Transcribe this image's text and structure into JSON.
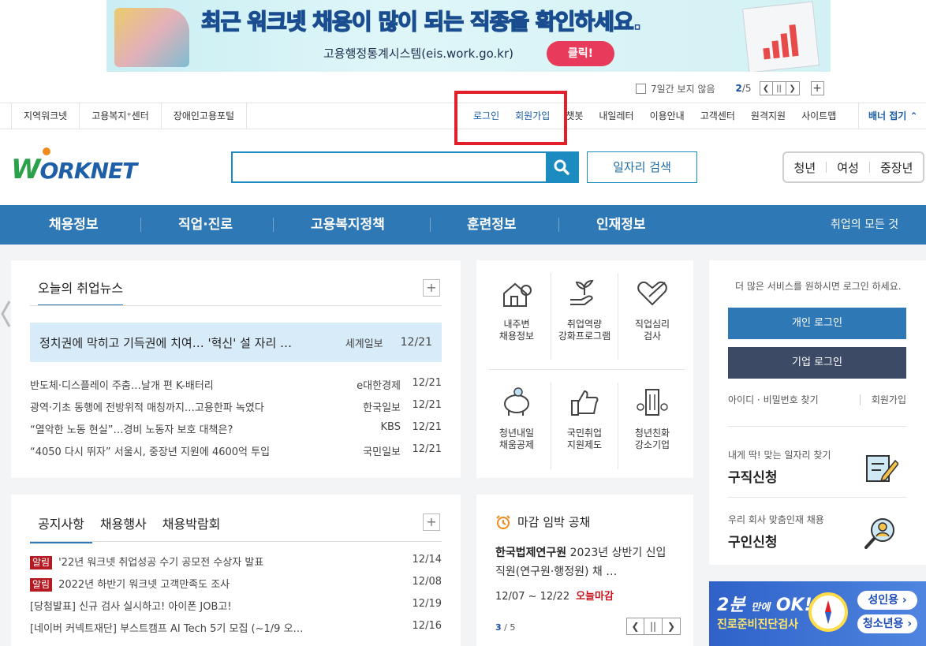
{
  "banner": {
    "headline_a": "최근 워크넷 채용이 많이 되는 ",
    "headline_b": "직종",
    "headline_c": "을 ",
    "headline_d": "확인",
    "headline_e": "하세요.",
    "sub": "고용행정통계시스템(eis.work.go.kr)",
    "click": "클릭!",
    "hide_7days": "7일간 보지 않음",
    "page_current": "2",
    "page_total": "/5"
  },
  "util_left": [
    "지역워크넷",
    "고용복지⁺센터",
    "장애인고용포털"
  ],
  "util_right": [
    "로그인",
    "회원가입",
    "챗봇",
    "내일레터",
    "이용안내",
    "고객센터",
    "원격지원",
    "사이트맵"
  ],
  "banner_close": "배너 접기",
  "logo": {
    "w": "W",
    "rest": "ORKNET"
  },
  "search": {
    "value": "",
    "job_search": "일자리 검색"
  },
  "age_tabs": [
    "청년",
    "여성",
    "중장년"
  ],
  "gnb": [
    "채용정보",
    "직업·진로",
    "고용복지정책",
    "훈련정보",
    "인재정보"
  ],
  "gnb_all": "취업의 모든 것",
  "news": {
    "title": "오늘의 취업뉴스",
    "headline": {
      "title": "정치권에 막히고 기득권에 치여… '혁신' 설 자리 …",
      "source": "세계일보",
      "date": "12/21"
    },
    "items": [
      {
        "title": "반도체·디스플레이 주춤…날개 편 K-배터리",
        "source": "e대한경제",
        "date": "12/21"
      },
      {
        "title": "광역·기초 동행에 전방위적 매칭까지…고용한파 녹였다",
        "source": "한국일보",
        "date": "12/21"
      },
      {
        "title": "“열악한 노동 현실”…경비 노동자 보호 대책은?",
        "source": "KBS",
        "date": "12/21"
      },
      {
        "title": "“4050 다시 뛰자” 서울시, 중장년 지원에 4600억 투입",
        "source": "국민일보",
        "date": "12/21"
      }
    ]
  },
  "services": [
    {
      "l1": "내주변",
      "l2": "채용정보",
      "icon": "house-pin-icon"
    },
    {
      "l1": "취업역량",
      "l2": "강화프로그램",
      "icon": "sprout-hand-icon"
    },
    {
      "l1": "직업심리",
      "l2": "검사",
      "icon": "heart-pencil-icon"
    },
    {
      "l1": "청년내일",
      "l2": "채움공제",
      "icon": "piggy-bank-icon"
    },
    {
      "l1": "국민취업",
      "l2": "지원제도",
      "icon": "thumbs-up-icon"
    },
    {
      "l1": "청년친화",
      "l2": "강소기업",
      "icon": "building-icon"
    }
  ],
  "login": {
    "msg": "더 많은 서비스를 원하시면 로그인 하세요.",
    "personal": "개인 로그인",
    "company": "기업 로그인",
    "find": "아이디 · 비밀번호 찾기",
    "join": "회원가입",
    "job_apply_sm": "내게 딱! 맞는 일자리 찾기",
    "job_apply_big": "구직신청",
    "hire_apply_sm": "우리 회사 맞춤인재 채용",
    "hire_apply_big": "구인신청"
  },
  "notices": {
    "tabs": [
      "공지사항",
      "채용행사",
      "채용박람회"
    ],
    "tag": "알림",
    "items": [
      {
        "tag": true,
        "title": "'22년 워크넷 취업성공 수기 공모전 수상자 발표",
        "date": "12/14"
      },
      {
        "tag": true,
        "title": "2022년 하반기 워크넷 고객만족도 조사",
        "date": "12/08"
      },
      {
        "tag": false,
        "title": "[당첨발표] 신규 검사 실시하고! 아이폰 JOB고!",
        "date": "12/19"
      },
      {
        "tag": false,
        "title": "[네이버 커넥트재단] 부스트캠프 AI Tech 5기 모집 (~1/9 오…",
        "date": "12/16"
      }
    ]
  },
  "deadline": {
    "title": "마감 임박 공채",
    "company": "한국법제연구원",
    "desc": "2023년 상반기 신입 직원(연구원·행정원) 채 …",
    "period": "12/07 ~ 12/22",
    "status": "오늘마감",
    "page_current": "3",
    "page_total": " / 5"
  },
  "quiz": {
    "line1a": "2분",
    "line1b": "만에",
    "line1c": "OK!",
    "line2": "진로준비진단검사",
    "adult": "성인용 ›",
    "youth": "청소년용 ›"
  },
  "colors": {
    "brand_blue": "#2f78b6",
    "search_blue": "#1c8bbf",
    "highlight_red": "#e2202a",
    "tag_red": "#b51a23",
    "company_login": "#3d4a66"
  }
}
